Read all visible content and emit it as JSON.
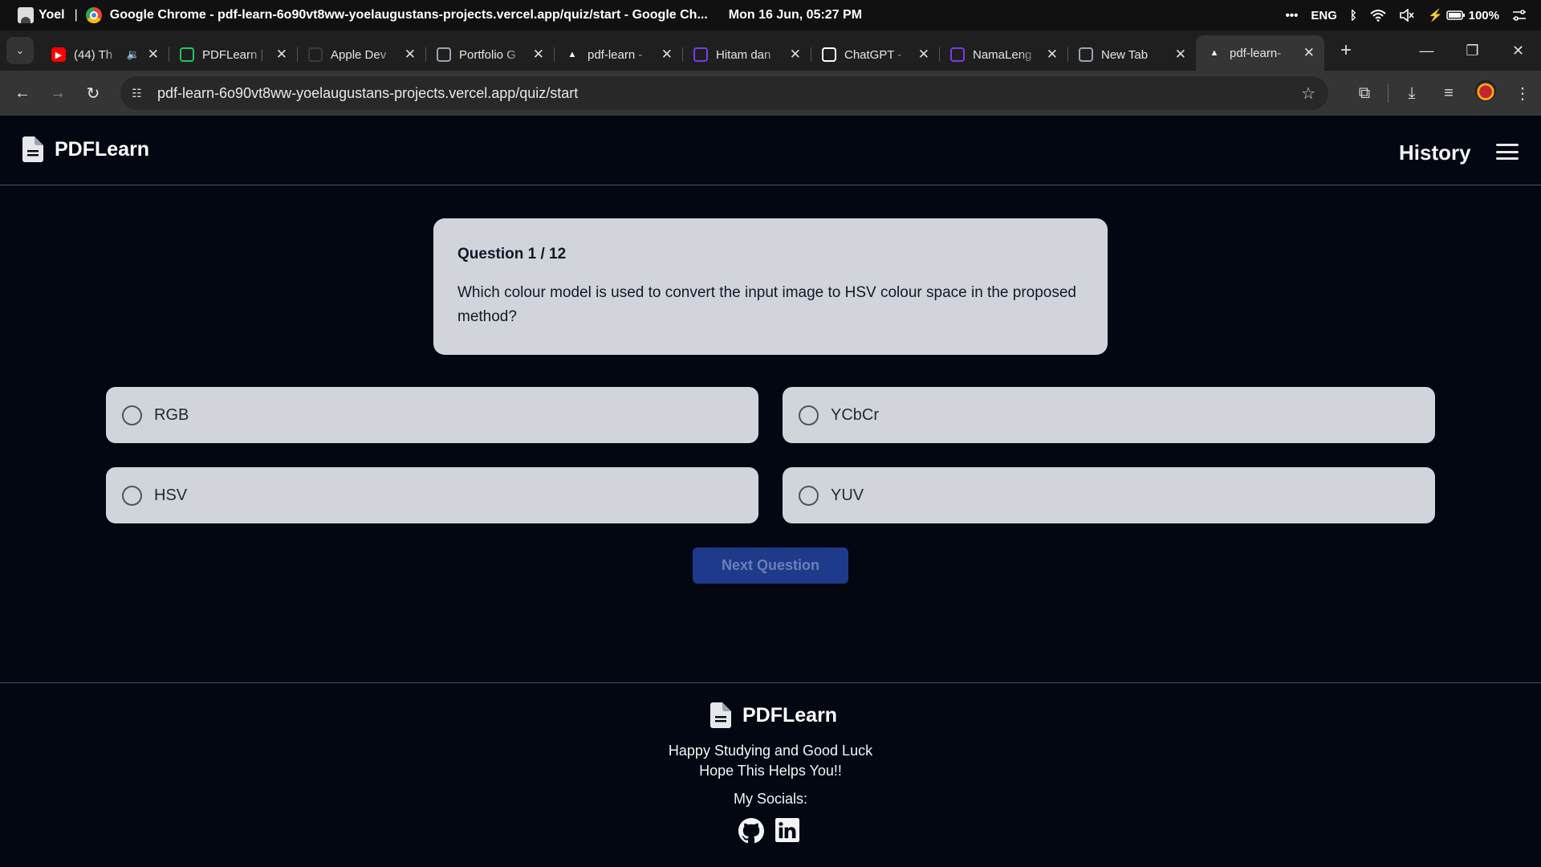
{
  "os_bar": {
    "user": "Yoel",
    "separator": "|",
    "window_title": "Google Chrome  -  pdf-learn-6o90vt8ww-yoelaugustans-projects.vercel.app/quiz/start - Google Ch...",
    "datetime": "Mon 16 Jun, 05:27 PM",
    "overflow": "•••",
    "language": "ENG",
    "battery": "100%"
  },
  "tabs": [
    {
      "label": "(44) Th",
      "favicon_color": "#ff0000",
      "favicon": "youtube-icon",
      "audio": true
    },
    {
      "label": "PDFLearn |",
      "favicon_color": "#22c55e",
      "favicon": "pdflearn-icon"
    },
    {
      "label": "Apple Dev",
      "favicon_color": "#3a3a3a",
      "favicon": "apple-dev-icon"
    },
    {
      "label": "Portfolio G",
      "favicon_color": "#9ca3af",
      "favicon": "globe-icon"
    },
    {
      "label": "pdf-learn -",
      "favicon_color": "#ffffff",
      "favicon": "vercel-icon"
    },
    {
      "label": "Hitam dan",
      "favicon_color": "#7c3aed",
      "favicon": "canva-icon"
    },
    {
      "label": "ChatGPT -",
      "favicon_color": "#ffffff",
      "favicon": "chatgpt-icon"
    },
    {
      "label": "NamaLeng",
      "favicon_color": "#7c3aed",
      "favicon": "canva-icon"
    },
    {
      "label": "New Tab",
      "favicon_color": "#9ca3af",
      "favicon": "chrome-icon"
    },
    {
      "label": "pdf-learn-",
      "favicon_color": "#ffffff",
      "favicon": "vercel-icon",
      "active": true
    }
  ],
  "browser": {
    "url": "pdf-learn-6o90vt8ww-yoelaugustans-projects.vercel.app/quiz/start"
  },
  "site": {
    "brand": "PDFLearn",
    "history_label": "History"
  },
  "quiz": {
    "progress_label": "Question 1 / 12",
    "question": "Which colour model is used to convert the input image to HSV colour space in the proposed method?",
    "options": [
      "RGB",
      "YCbCr",
      "HSV",
      "YUV"
    ],
    "next_label": "Next Question",
    "colors": {
      "card": "#d1d5db",
      "button": "#1e3a8a",
      "background": "#030712"
    }
  },
  "footer": {
    "brand": "PDFLearn",
    "tagline_1": "Happy Studying and Good Luck",
    "tagline_2": "Hope This Helps You!!",
    "socials_label": "My Socials:",
    "socials": [
      "github-icon",
      "linkedin-icon"
    ]
  }
}
